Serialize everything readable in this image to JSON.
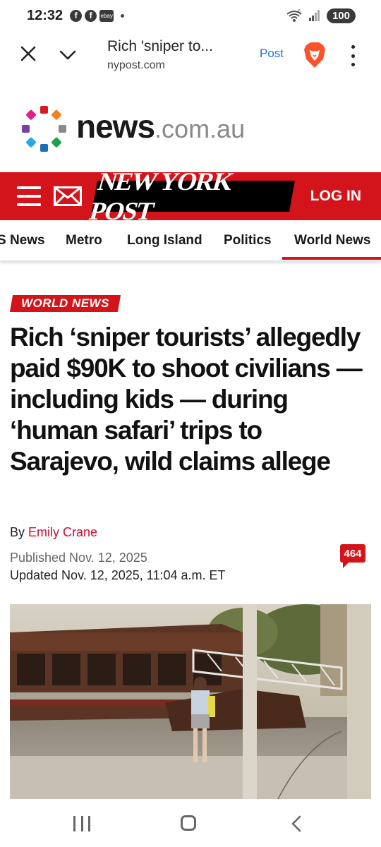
{
  "status_bar": {
    "time": "12:32",
    "notif_icons": [
      "facebook-icon",
      "facebook-icon",
      "ebay-icon"
    ],
    "ebay_label": "ebay",
    "battery": "100",
    "wifi_label": "6"
  },
  "browser": {
    "page_title": "Rich 'sniper to...",
    "url": "nypost.com",
    "post_button": "Post",
    "icons": [
      "close-icon",
      "chevron-down-icon",
      "brave-lion-icon",
      "more-vert-icon"
    ]
  },
  "ad": {
    "brand_main": "news",
    "brand_suffix": ".com.au"
  },
  "site_header": {
    "logo": "NEW YORK POST",
    "login": "LOG IN",
    "accent_color": "#d3141a"
  },
  "nav": {
    "items": [
      "S News",
      "Metro",
      "Long Island",
      "Politics",
      "World News"
    ],
    "active": "World News"
  },
  "article": {
    "section": "WORLD NEWS",
    "headline": "Rich ‘sniper tourists’ allegedly paid $90K to shoot civilians — including kids — during ‘human safari’ trips to Sarajevo, wild claims allege",
    "by_prefix": "By",
    "author": "Emily Crane",
    "published": "Published Nov. 12, 2025",
    "updated": "Updated Nov. 12, 2025, 11:04 a.m. ET",
    "comment_count": "464"
  },
  "android_nav": {
    "icons": [
      "recent-apps-icon",
      "home-icon",
      "back-icon"
    ]
  }
}
